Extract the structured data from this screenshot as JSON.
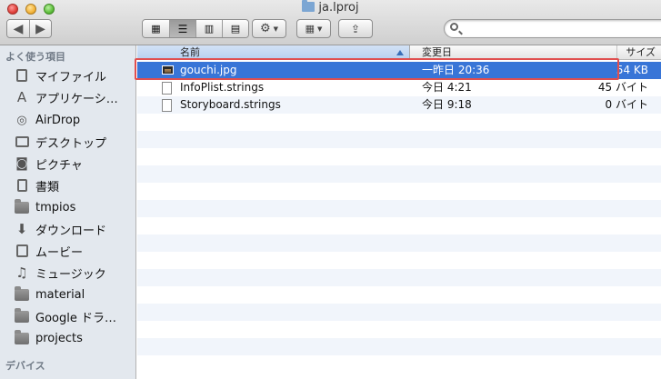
{
  "window": {
    "title": "ja.lproj"
  },
  "toolbar": {
    "search_placeholder": ""
  },
  "sidebar": {
    "sections": [
      {
        "heading": "よく使う項目"
      },
      {
        "heading": "デバイス"
      }
    ],
    "items": [
      {
        "label": "マイファイル",
        "icon": "all-files-icon"
      },
      {
        "label": "アプリケーシ…",
        "icon": "applications-icon"
      },
      {
        "label": "AirDrop",
        "icon": "airdrop-icon"
      },
      {
        "label": "デスクトップ",
        "icon": "desktop-icon"
      },
      {
        "label": "ピクチャ",
        "icon": "camera-icon"
      },
      {
        "label": "書類",
        "icon": "documents-icon"
      },
      {
        "label": "tmpios",
        "icon": "folder-icon"
      },
      {
        "label": "ダウンロード",
        "icon": "download-icon"
      },
      {
        "label": "ムービー",
        "icon": "movies-icon"
      },
      {
        "label": "ミュージック",
        "icon": "music-icon"
      },
      {
        "label": "material",
        "icon": "folder-icon"
      },
      {
        "label": "Google ドラ…",
        "icon": "folder-icon"
      },
      {
        "label": "projects",
        "icon": "folder-icon"
      }
    ]
  },
  "columns": {
    "name": "名前",
    "date": "変更日",
    "size": "サイズ"
  },
  "files": [
    {
      "name": "gouchi.jpg",
      "date": "一昨日 20:36",
      "size": "54 KB",
      "selected": true,
      "icon": "image-file-icon"
    },
    {
      "name": "InfoPlist.strings",
      "date": "今日 4:21",
      "size": "45 バイト",
      "selected": false,
      "icon": "document-file-icon"
    },
    {
      "name": "Storyboard.strings",
      "date": "今日 9:18",
      "size": "0 バイト",
      "selected": false,
      "icon": "document-file-icon"
    }
  ],
  "colors": {
    "selection": "#3875d7",
    "highlight_border": "#e04f4f",
    "sidebar_bg": "#e3e8ee"
  }
}
